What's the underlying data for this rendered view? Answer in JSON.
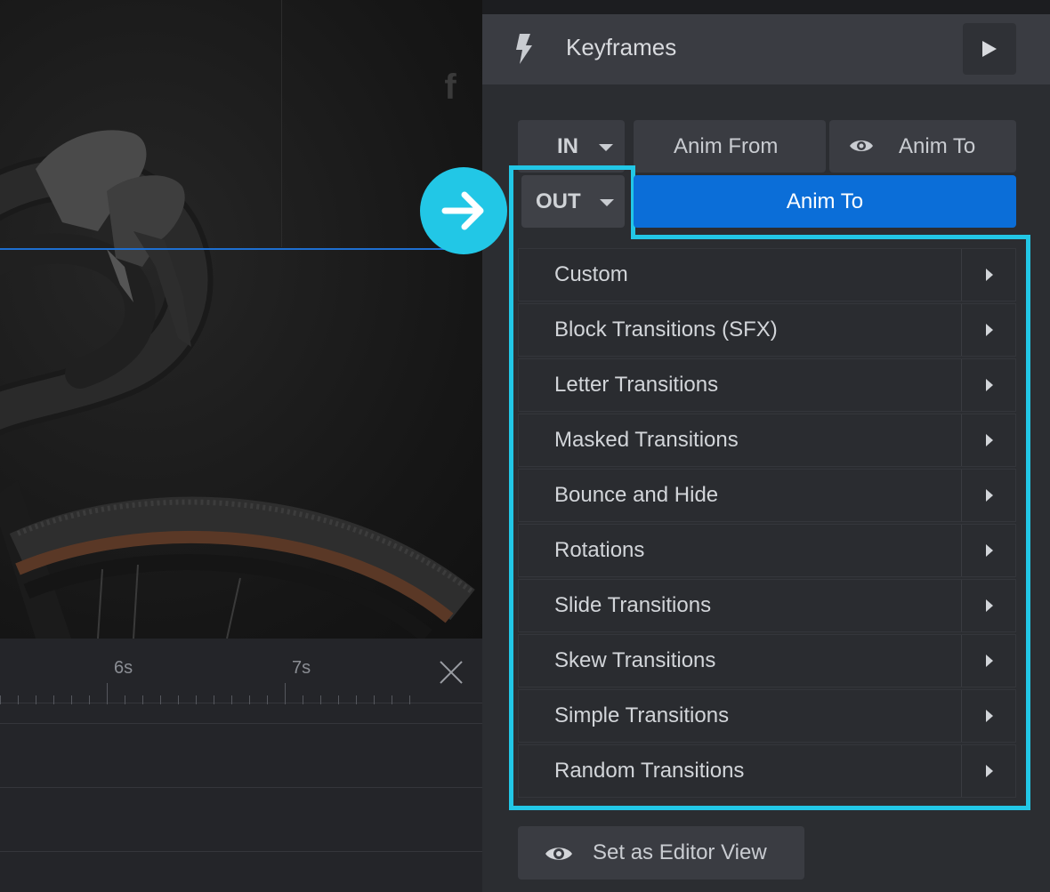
{
  "canvas": {
    "social_icon": "f"
  },
  "timeline": {
    "ticks": [
      {
        "label": "6s"
      },
      {
        "label": "7s"
      }
    ]
  },
  "panel": {
    "header": {
      "title": "Keyframes",
      "icons": {
        "left": "bolt-icon",
        "right": "play-icon"
      }
    },
    "row_in": {
      "direction": "IN",
      "anim_from": "Anim From",
      "anim_to": "Anim To"
    },
    "row_out": {
      "direction": "OUT",
      "anim_to": "Anim To"
    },
    "menu": [
      {
        "label": "Custom"
      },
      {
        "label": "Block Transitions (SFX)"
      },
      {
        "label": "Letter Transitions"
      },
      {
        "label": "Masked Transitions"
      },
      {
        "label": "Bounce and Hide"
      },
      {
        "label": "Rotations"
      },
      {
        "label": "Slide Transitions"
      },
      {
        "label": "Skew Transitions"
      },
      {
        "label": "Simple Transitions"
      },
      {
        "label": "Random Transitions"
      }
    ],
    "footer_button": "Set as Editor View"
  },
  "colors": {
    "accent_blue": "#0b6ed8",
    "highlight_cyan": "#22c7e6",
    "panel_bg": "#2b2d31"
  }
}
